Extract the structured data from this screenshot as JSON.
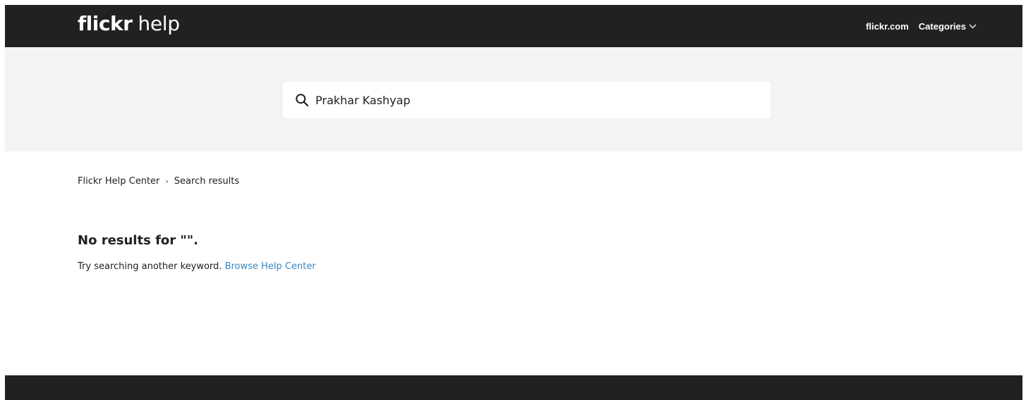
{
  "header": {
    "logo_word": "flickr",
    "logo_suffix": "help",
    "nav": {
      "flickr_link": "flickr.com",
      "categories_label": "Categories"
    }
  },
  "search": {
    "value": "Prakhar Kashyap",
    "icon": "search-icon"
  },
  "breadcrumb": {
    "home": "Flickr Help Center",
    "separator": "›",
    "current": "Search results"
  },
  "results": {
    "title": "No results for \"\".",
    "hint": "Try searching another keyword. ",
    "browse_link": "Browse Help Center"
  },
  "colors": {
    "header_bg": "#212124",
    "search_band_bg": "#f3f3f3",
    "link_blue": "#3b88c3"
  }
}
